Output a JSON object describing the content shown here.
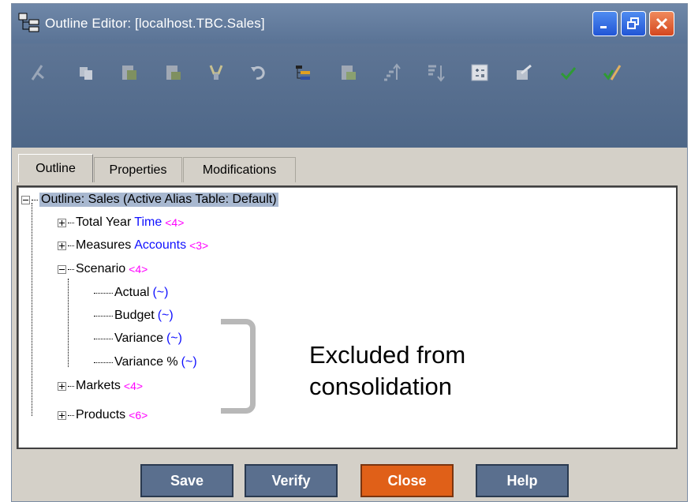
{
  "window": {
    "title": "Outline Editor: [localhost.TBC.Sales]",
    "icons": [
      "app-outline-icon",
      "minimize-icon",
      "restore-icon",
      "close-icon"
    ]
  },
  "toolbar": {
    "tools": [
      "cut-icon",
      "copy-icon",
      "paste-icon",
      "paste-child-icon",
      "find-icon",
      "undo-icon",
      "add-sibling-icon",
      "add-child-icon",
      "move-up-icon",
      "move-down-icon",
      "calculator-icon",
      "properties-icon",
      "verify-check-icon",
      "edit-check-icon"
    ]
  },
  "tabs": [
    {
      "label": "Outline",
      "active": true
    },
    {
      "label": "Properties",
      "active": false
    },
    {
      "label": "Modifications",
      "active": false
    }
  ],
  "tree": {
    "root": "Outline: Sales (Active Alias Table: Default)",
    "nodes": [
      {
        "label": "Total Year",
        "type": "Time",
        "count": "<4>"
      },
      {
        "label": "Measures",
        "type": "Accounts",
        "count": "<3>"
      },
      {
        "label": "Scenario",
        "count": "<4>"
      },
      {
        "label": "Markets",
        "count": "<4>"
      },
      {
        "label": "Products",
        "count": "<6>"
      }
    ],
    "scenario_children": [
      {
        "label": "Actual",
        "cons": "(~)"
      },
      {
        "label": "Budget",
        "cons": "(~)"
      },
      {
        "label": "Variance",
        "cons": "(~)"
      },
      {
        "label": "Variance %",
        "cons": "(~)"
      }
    ]
  },
  "annotation": {
    "line1": "Excluded from",
    "line2": "consolidation"
  },
  "buttons": {
    "save": "Save",
    "verify": "Verify",
    "close": "Close",
    "help": "Help"
  },
  "colors": {
    "titlebar": "#5a7395",
    "member_type": "#1010ff",
    "member_count": "#ff00ff",
    "close_button": "#e06018",
    "action_button": "#5a6f8e"
  }
}
